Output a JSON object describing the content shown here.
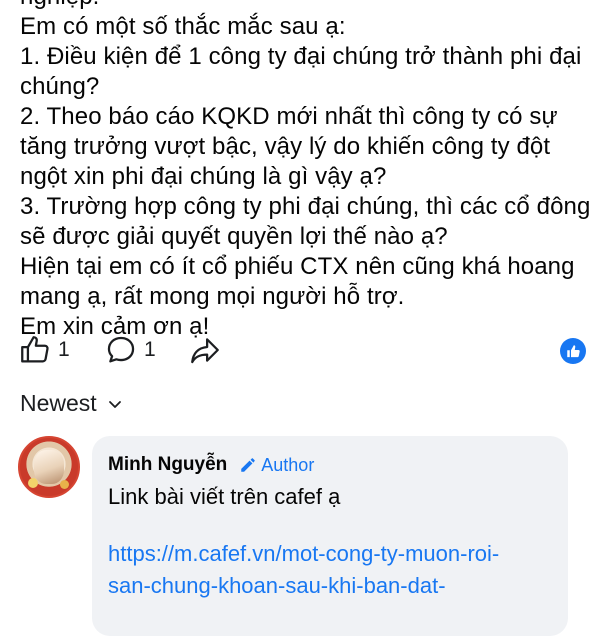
{
  "post": {
    "lines": [
      "nghiệp.",
      "Em có một số thắc mắc sau ạ:",
      "1. Điều kiện để 1 công ty đại chúng trở thành phi đại",
      "chúng?",
      "2. Theo báo cáo KQKD mới nhất thì công ty có sự",
      "tăng trưởng vượt bậc, vậy lý do khiến công ty đột",
      "ngột xin phi đại chúng là gì vậy ạ?",
      "3. Trường hợp công ty phi đại chúng, thì các cổ đông",
      "sẽ được giải quyết quyền lợi thế nào ạ?",
      "Hiện tại em có ít cổ phiếu CTX nên cũng khá hoang",
      "mang ạ, rất mong mọi người hỗ trợ.",
      "Em xin cảm ơn ạ!"
    ]
  },
  "actions": {
    "like_count": "1",
    "comment_count": "1",
    "like_icon": "thumbs-up-icon",
    "comment_icon": "comment-bubble-icon",
    "share_icon": "share-arrow-icon",
    "reaction_badge_icon": "like-reaction-badge",
    "accent_color": "#1877f2"
  },
  "comments": {
    "sort_label": "Newest",
    "items": [
      {
        "name": "Minh Nguyễn",
        "badge": "Author",
        "text": "Link bài viết trên cafef ạ",
        "link_lines": [
          "https://m.cafef.vn/mot-cong-ty-muon-roi-",
          "san-chung-khoan-sau-khi-ban-dat-"
        ]
      }
    ]
  }
}
